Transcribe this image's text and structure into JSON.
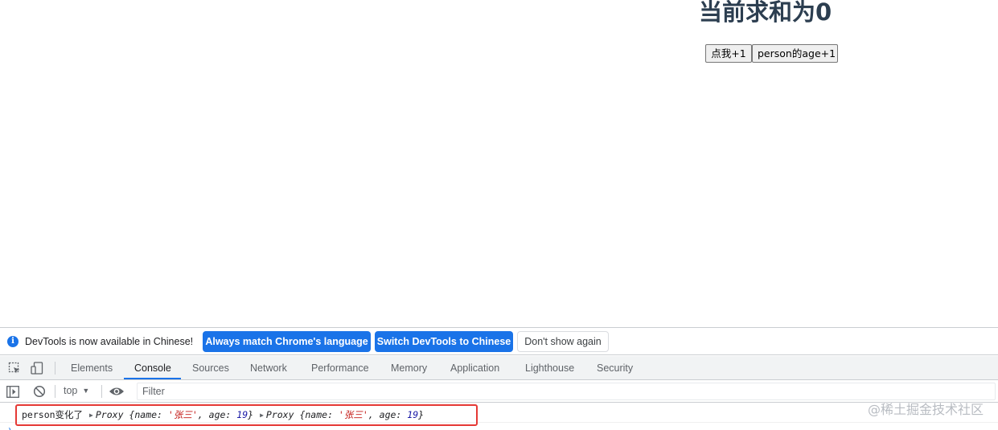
{
  "page": {
    "heading": "当前求和为0",
    "buttons": {
      "increment": "点我+1",
      "age": "person的age+1"
    }
  },
  "devtools": {
    "infobar": {
      "message": "DevTools is now available in Chinese!",
      "match_label": "Always match Chrome's language",
      "switch_label": "Switch DevTools to Chinese",
      "dismiss_label": "Don't show again"
    },
    "tabs": [
      {
        "label": "Elements",
        "active": false
      },
      {
        "label": "Console",
        "active": true
      },
      {
        "label": "Sources",
        "active": false
      },
      {
        "label": "Network",
        "active": false
      },
      {
        "label": "Performance",
        "active": false
      },
      {
        "label": "Memory",
        "active": false
      },
      {
        "label": "Application",
        "active": false
      },
      {
        "label": "Lighthouse",
        "active": false
      },
      {
        "label": "Security",
        "active": false
      }
    ],
    "toolbar": {
      "context": "top",
      "filter_placeholder": "Filter"
    },
    "console": {
      "message_prefix": "person变化了",
      "entries": [
        {
          "type": "Proxy",
          "name": "张三",
          "age": "19"
        },
        {
          "type": "Proxy",
          "name": "张三",
          "age": "19"
        }
      ]
    }
  },
  "watermark": "@稀土掘金技术社区",
  "colors": {
    "accent": "#1a73e8",
    "heading": "#2c3e50",
    "highlight": "#e53935",
    "string": "#c41a16",
    "number": "#1a1aa6"
  }
}
